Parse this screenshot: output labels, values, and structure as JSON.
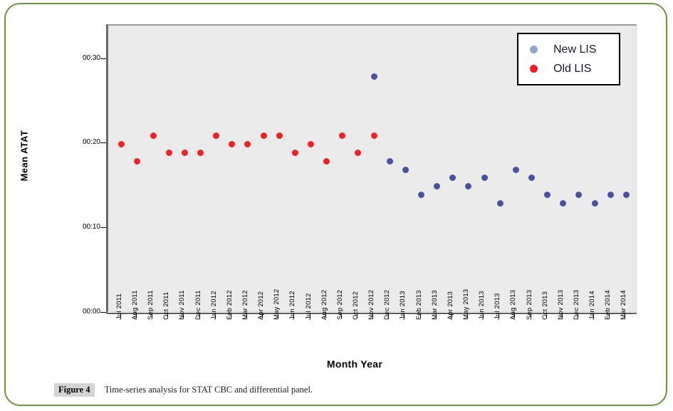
{
  "figure": {
    "caption_tag": "Figure 4",
    "caption_text": "Time-series analysis for STAT CBC and differential panel.",
    "border_color": "#6e9442"
  },
  "legend": {
    "entries": [
      {
        "label": "New LIS",
        "color": "#8aa8cc",
        "icon": "circle-marker-icon"
      },
      {
        "label": "Old LIS",
        "color": "#ee1c1c",
        "icon": "circle-marker-icon"
      }
    ]
  },
  "chart_data": {
    "type": "scatter",
    "title": "",
    "xlabel": "Month Year",
    "ylabel": "Mean ATAT",
    "ytick_labels": [
      "00:00",
      "00:10",
      "00:20",
      "00:30"
    ],
    "ytick_values": [
      0,
      10,
      20,
      30
    ],
    "ylim": [
      0,
      34
    ],
    "grid": false,
    "legend_position": "top-right",
    "panel_background": "#ebebeb",
    "categories": [
      "Jul 2011",
      "Aug 2011",
      "Sep 2011",
      "Oct 2011",
      "Nov 2011",
      "Dec 2011",
      "Jan 2012",
      "Feb 2012",
      "Mar 2012",
      "Apr 2012",
      "May 2012",
      "Jun 2012",
      "Jul 2012",
      "Aug 2012",
      "Sep 2012",
      "Oct 2012",
      "Nov 2012",
      "Dec 2012",
      "Jan 2013",
      "Feb 2013",
      "Mar 2013",
      "Apr 2013",
      "May 2013",
      "Jun 2013",
      "Jul 2013",
      "Aug 2013",
      "Sep 2013",
      "Oct 2013",
      "Nov 2013",
      "Dec 2013",
      "Jan 2014",
      "Feb 2014",
      "Mar 2014"
    ],
    "series": [
      {
        "name": "Old LIS",
        "color": "#ee2222",
        "points": [
          {
            "x": "Jul 2011",
            "y": 20
          },
          {
            "x": "Aug 2011",
            "y": 18
          },
          {
            "x": "Sep 2011",
            "y": 21
          },
          {
            "x": "Oct 2011",
            "y": 19
          },
          {
            "x": "Nov 2011",
            "y": 19
          },
          {
            "x": "Dec 2011",
            "y": 19
          },
          {
            "x": "Jan 2012",
            "y": 21
          },
          {
            "x": "Feb 2012",
            "y": 20
          },
          {
            "x": "Mar 2012",
            "y": 20
          },
          {
            "x": "Apr 2012",
            "y": 21
          },
          {
            "x": "May 2012",
            "y": 21
          },
          {
            "x": "Jun 2012",
            "y": 19
          },
          {
            "x": "Jul 2012",
            "y": 20
          },
          {
            "x": "Aug 2012",
            "y": 18
          },
          {
            "x": "Sep 2012",
            "y": 21
          },
          {
            "x": "Oct 2012",
            "y": 19
          },
          {
            "x": "Nov 2012",
            "y": 21
          }
        ]
      },
      {
        "name": "New LIS",
        "color": "#4a51a3",
        "points": [
          {
            "x": "Nov 2012",
            "y": 28
          },
          {
            "x": "Dec 2012",
            "y": 18
          },
          {
            "x": "Jan 2013",
            "y": 17
          },
          {
            "x": "Feb 2013",
            "y": 14
          },
          {
            "x": "Mar 2013",
            "y": 15
          },
          {
            "x": "Apr 2013",
            "y": 16
          },
          {
            "x": "May 2013",
            "y": 15
          },
          {
            "x": "Jun 2013",
            "y": 16
          },
          {
            "x": "Jul 2013",
            "y": 13
          },
          {
            "x": "Aug 2013",
            "y": 17
          },
          {
            "x": "Sep 2013",
            "y": 16
          },
          {
            "x": "Oct 2013",
            "y": 14
          },
          {
            "x": "Nov 2013",
            "y": 13
          },
          {
            "x": "Dec 2013",
            "y": 14
          },
          {
            "x": "Jan 2014",
            "y": 13
          },
          {
            "x": "Feb 2014",
            "y": 14
          },
          {
            "x": "Mar 2014",
            "y": 14
          }
        ]
      }
    ]
  }
}
